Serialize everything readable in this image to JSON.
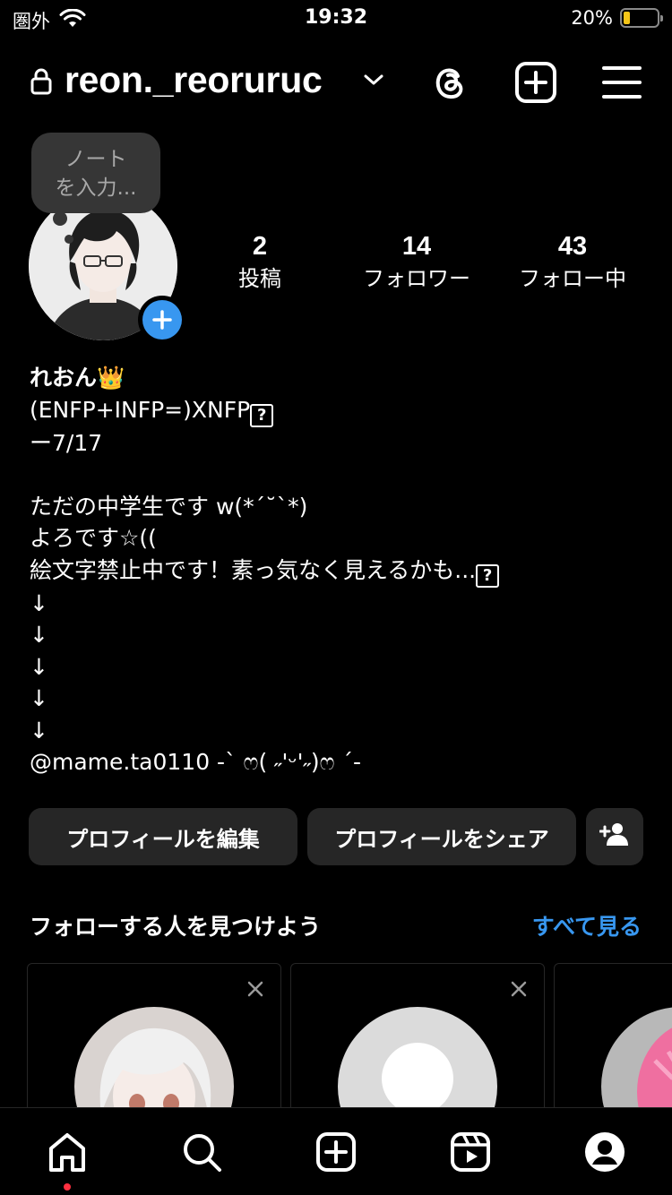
{
  "status_bar": {
    "carrier": "圏外",
    "time": "19:32",
    "battery_percent_text": "20%",
    "battery_level": 0.2,
    "battery_color": "#f5c518"
  },
  "header": {
    "username": "reon._reoruruc",
    "icons": [
      "lock-icon",
      "chevron-down-icon",
      "threads-icon",
      "create-icon",
      "menu-icon"
    ]
  },
  "note": {
    "placeholder_line1": "ノート",
    "placeholder_line2": "を入力..."
  },
  "stats": [
    {
      "value": "2",
      "label": "投稿"
    },
    {
      "value": "14",
      "label": "フォロワー"
    },
    {
      "value": "43",
      "label": "フォロー中"
    }
  ],
  "bio": {
    "name": "れおん👑",
    "line1": "(ENFP+INFP=)XNFP",
    "line2": "ー7/17",
    "line3": "ただの中学生です w(*´˘`*)",
    "line4": "よろです☆((",
    "line5": "絵文字禁止中です！素っ気なく見えるかも...",
    "arrow": "↓",
    "mention": "@mame.ta0110 -ˋ ෆ( ˶'ᵕ'˶)ෆ ˊ-",
    "missing_glyph": "?"
  },
  "buttons": {
    "edit_profile": "プロフィールを編集",
    "share_profile": "プロフィールをシェア"
  },
  "suggestions": {
    "title": "フォローする人を見つけよう",
    "see_all": "すべて見る"
  },
  "colors": {
    "accent": "#3897f0",
    "button_bg": "#262626",
    "notification_dot": "#ff3040"
  },
  "nav": [
    "home-icon",
    "search-icon",
    "create-icon",
    "reels-icon",
    "profile-icon"
  ]
}
